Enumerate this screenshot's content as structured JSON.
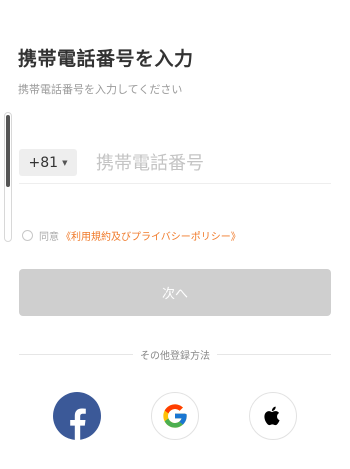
{
  "header": {
    "title": "携帯電話番号を入力",
    "subtitle": "携帯電話番号を入力してください"
  },
  "phone": {
    "country_code": "+81",
    "caret": "▼",
    "placeholder": "携帯電話番号",
    "value": ""
  },
  "agreement": {
    "prefix": "同意",
    "link_text": "《利用規約及びプライバシーポリシー》",
    "checked": false
  },
  "next_button": {
    "label": "次へ",
    "enabled": false
  },
  "other_login": {
    "label": "その他登録方法",
    "providers": [
      {
        "name": "facebook",
        "icon": "facebook-icon",
        "color": "#3b5998"
      },
      {
        "name": "google",
        "icon": "google-icon"
      },
      {
        "name": "apple",
        "icon": "apple-icon"
      }
    ]
  },
  "colors": {
    "accent_link": "#f07a2a",
    "button_disabled": "#cfcfcf",
    "facebook": "#3b5998"
  }
}
